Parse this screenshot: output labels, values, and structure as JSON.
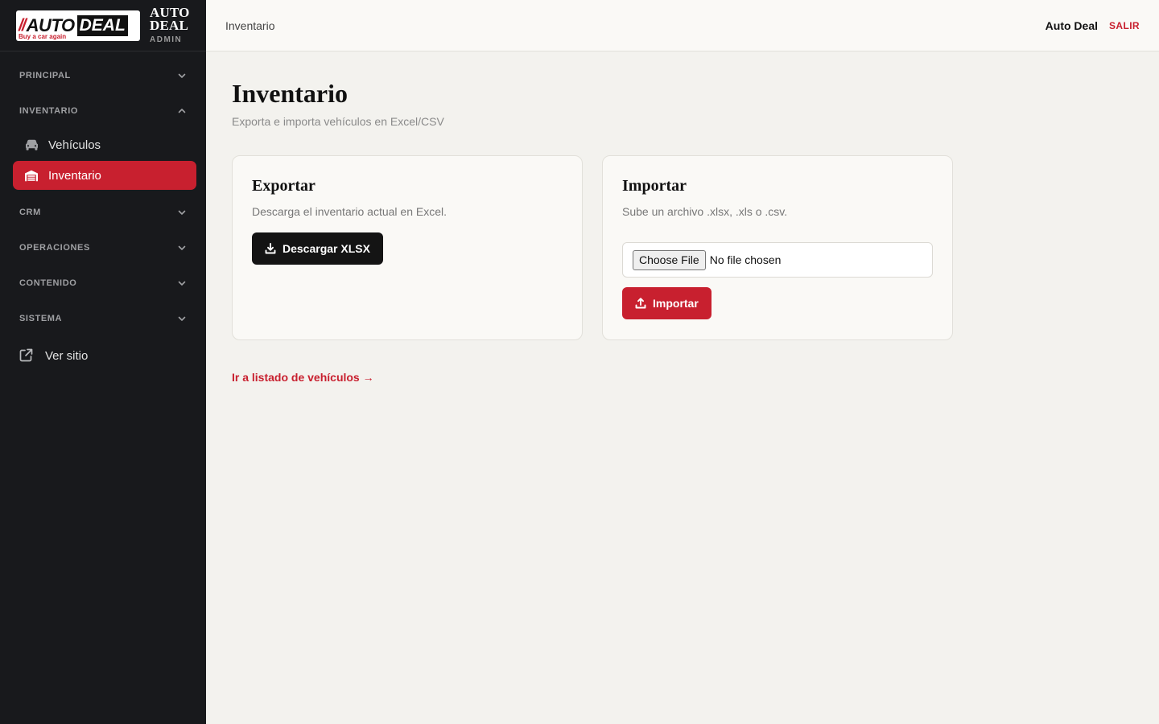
{
  "brand": {
    "logo_slashes": "//",
    "logo_auto": "AUTO",
    "logo_deal": "DEAL",
    "logo_tagline": "Buy a car again",
    "name_line1": "AUTO",
    "name_line2": "DEAL",
    "role": "ADMIN"
  },
  "sidebar": {
    "groups": [
      {
        "label": "PRINCIPAL",
        "expanded": false
      },
      {
        "label": "INVENTARIO",
        "expanded": true
      },
      {
        "label": "CRM",
        "expanded": false
      },
      {
        "label": "OPERACIONES",
        "expanded": false
      },
      {
        "label": "CONTENIDO",
        "expanded": false
      },
      {
        "label": "SISTEMA",
        "expanded": false
      }
    ],
    "inventario_items": [
      {
        "label": "Vehículos",
        "icon": "car-icon",
        "active": false
      },
      {
        "label": "Inventario",
        "icon": "warehouse-icon",
        "active": true
      }
    ],
    "ver_sitio": {
      "label": "Ver sitio",
      "icon": "external-link-icon"
    }
  },
  "topbar": {
    "breadcrumb": "Inventario",
    "user": "Auto Deal",
    "logout": "SALIR"
  },
  "page": {
    "title": "Inventario",
    "subtitle": "Exporta e importa vehículos en Excel/CSV"
  },
  "export_card": {
    "title": "Exportar",
    "description": "Descarga el inventario actual en Excel.",
    "button": "Descargar XLSX"
  },
  "import_card": {
    "title": "Importar",
    "description": "Sube un archivo .xlsx, .xls o .csv.",
    "file_button": "Choose File",
    "file_status": "No file chosen",
    "button": "Importar"
  },
  "footer_link": "Ir a listado de vehículos →",
  "colors": {
    "accent": "#c8202f",
    "sidebar_bg": "#18191c",
    "page_bg": "#f3f2ee"
  }
}
